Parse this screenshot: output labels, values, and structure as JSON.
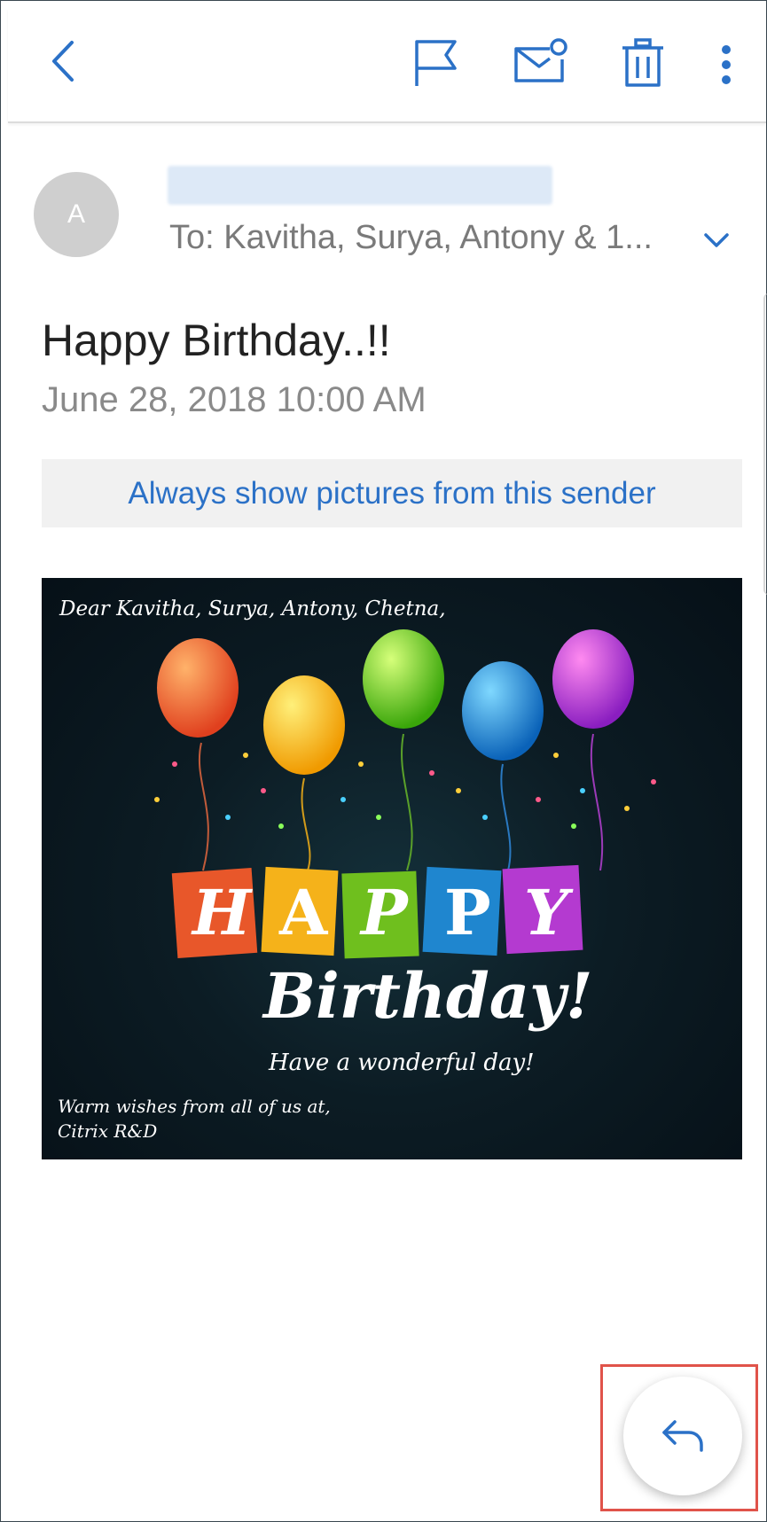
{
  "toolbar": {
    "back_icon": "chevron-left-icon",
    "flag_icon": "flag-icon",
    "mark_unread_icon": "mail-dot-icon",
    "delete_icon": "trash-icon",
    "more_icon": "more-vert-icon",
    "accent_color": "#2b71c7"
  },
  "message": {
    "avatar_initial": "A",
    "recipients": "To: Kavitha, Surya, Antony & 1...",
    "subject": "Happy Birthday..!!",
    "datetime": "June 28, 2018 10:00 AM",
    "show_pictures_label": "Always show pictures from this sender"
  },
  "card": {
    "greeting": "Dear Kavitha, Surya, Antony, Chetna,",
    "letters": [
      "H",
      "A",
      "P",
      "P",
      "Y"
    ],
    "headline": "Birthday!",
    "wish": "Have a wonderful day!",
    "sign_line1": "Warm wishes from all of us at,",
    "sign_line2": "Citrix R&D"
  },
  "fab": {
    "reply_icon": "reply-icon"
  }
}
